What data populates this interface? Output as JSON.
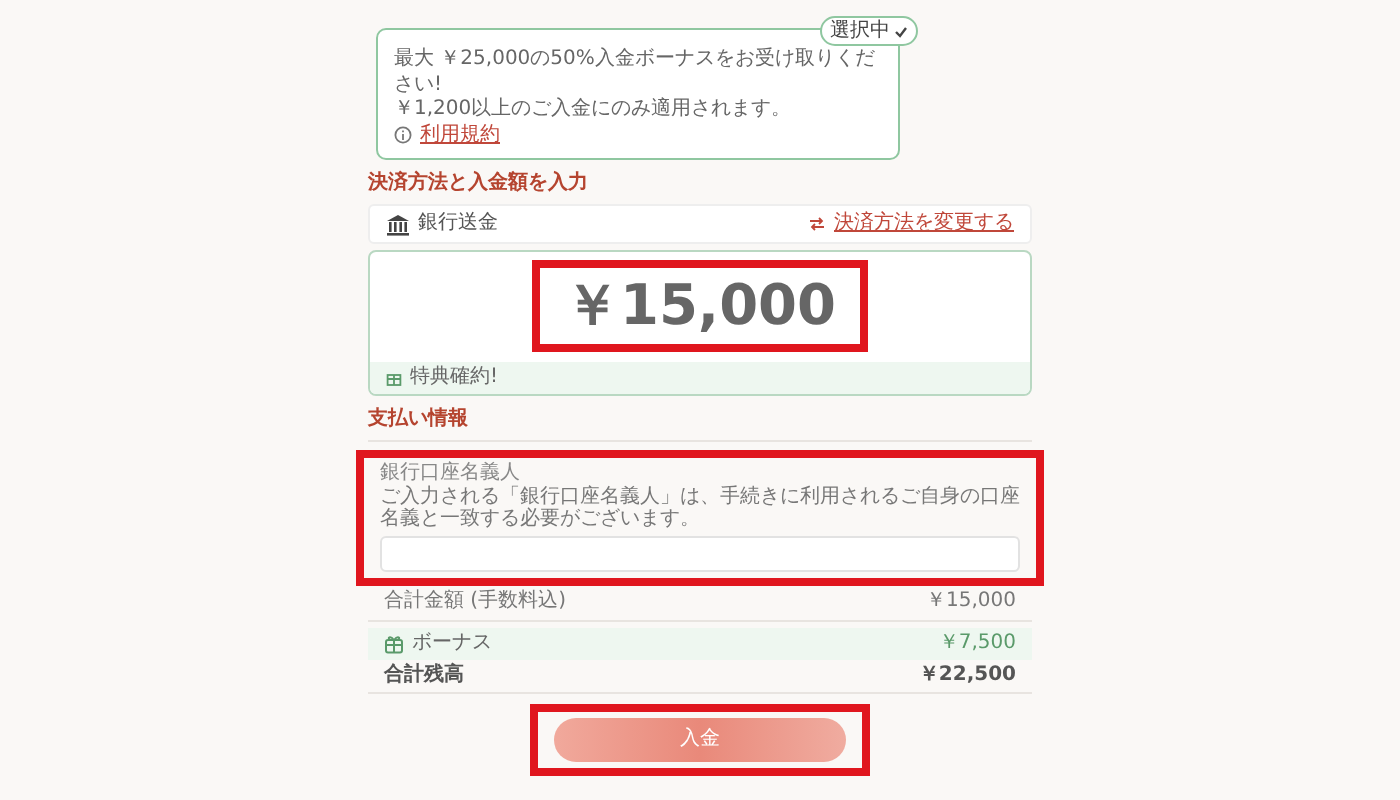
{
  "bonus_offer": {
    "badge": "選択中",
    "selected": true,
    "lines": [
      "最大 ￥25,000の50%入金ボーナスをお受け取りください!",
      "￥1,200以上のご入金にのみ適用されます。"
    ],
    "terms_link": "利用規約"
  },
  "payment_section": {
    "heading": "決済方法と入金額を入力",
    "method": "銀行送金",
    "change_link": "決済方法を変更する",
    "amount": "￥15,000",
    "amount_highlighted": true,
    "guarantee": "特典確約!"
  },
  "payment_info": {
    "heading": "支払い情報",
    "field": {
      "label": "銀行口座名義人",
      "note": "ご入力される「銀行口座名義人」は、手続きに利用されるご自身の口座名義と一致する必要がございます。",
      "highlighted": true
    }
  },
  "summary": [
    {
      "kind": "total",
      "label": "合計金額 (手数料込)",
      "value": "￥15,000"
    },
    {
      "kind": "bonus",
      "label": "ボーナス",
      "value": "￥7,500"
    },
    {
      "kind": "balance",
      "label": "合計残高",
      "value": "￥22,500"
    }
  ],
  "submit": {
    "label": "入金",
    "highlighted": true
  }
}
